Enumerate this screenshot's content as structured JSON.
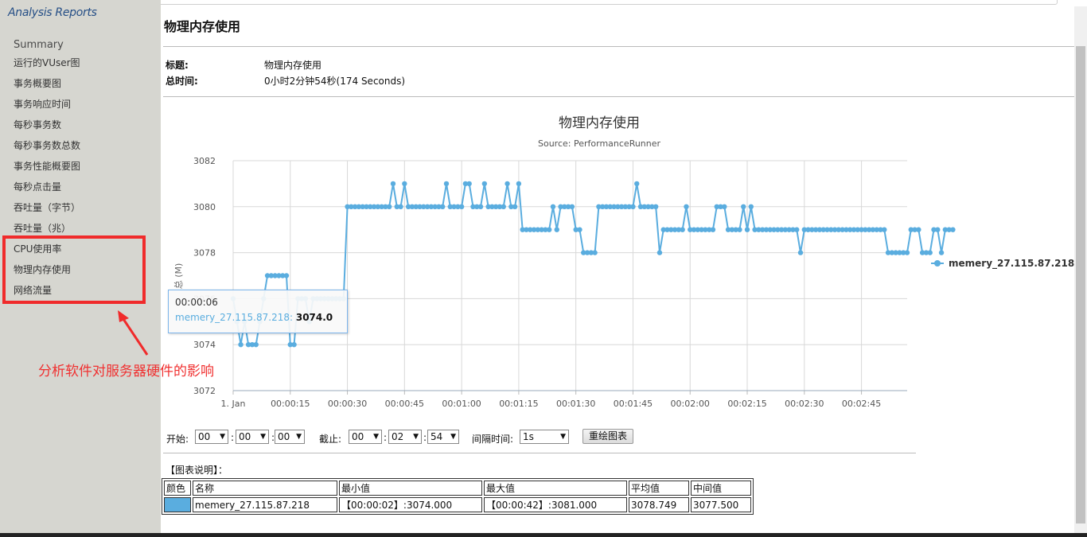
{
  "app": {
    "brand": "Analysis Reports"
  },
  "sidebar": {
    "items": [
      {
        "label": "Summary"
      },
      {
        "label": "运行的VUser图"
      },
      {
        "label": "事务概要图"
      },
      {
        "label": "事务响应时间"
      },
      {
        "label": "每秒事务数"
      },
      {
        "label": "每秒事务数总数"
      },
      {
        "label": "事务性能概要图"
      },
      {
        "label": "每秒点击量"
      },
      {
        "label": "吞吐量（字节）"
      },
      {
        "label": "吞吐量（兆）"
      },
      {
        "label": "CPU使用率"
      },
      {
        "label": "物理内存使用"
      },
      {
        "label": "网络流量"
      }
    ]
  },
  "annotation": {
    "text": "分析软件对服务器硬件的影响",
    "color": "#f03030"
  },
  "page": {
    "title": "物理内存使用",
    "info": [
      {
        "label": "标题:",
        "value": "物理内存使用"
      },
      {
        "label": "总时间:",
        "value": "0小时2分钟54秒(174 Seconds)"
      }
    ]
  },
  "chart_data": {
    "type": "line",
    "title": "物理内存使用",
    "subtitle": "Source: PerformanceRunner",
    "ylabel": "总 (M)",
    "ylim": [
      3072,
      3082
    ],
    "yticks": [
      "3082",
      "3080",
      "3078",
      "3076",
      "3074",
      "3072"
    ],
    "xlim": [
      0,
      177
    ],
    "xticks": [
      {
        "t": 0,
        "label": "1. Jan"
      },
      {
        "t": 15,
        "label": "00:00:15"
      },
      {
        "t": 30,
        "label": "00:00:30"
      },
      {
        "t": 45,
        "label": "00:00:45"
      },
      {
        "t": 60,
        "label": "00:01:00"
      },
      {
        "t": 75,
        "label": "00:01:15"
      },
      {
        "t": 90,
        "label": "00:01:30"
      },
      {
        "t": 105,
        "label": "00:01:45"
      },
      {
        "t": 120,
        "label": "00:02:00"
      },
      {
        "t": 135,
        "label": "00:02:15"
      },
      {
        "t": 150,
        "label": "00:02:30"
      },
      {
        "t": 165,
        "label": "00:02:45"
      }
    ],
    "grid": true,
    "legend_position": "right",
    "series": [
      {
        "name": "memery_27.115.87.218",
        "color": "#5aaddf",
        "values": [
          3076,
          3075,
          3074,
          3075,
          3074,
          3074,
          3074,
          3075,
          3076,
          3077,
          3077,
          3077,
          3077,
          3077,
          3077,
          3074,
          3074,
          3076,
          3076,
          3076,
          3075,
          3076,
          3076,
          3076,
          3076,
          3076,
          3076,
          3076,
          3076,
          3076,
          3080,
          3080,
          3080,
          3080,
          3080,
          3080,
          3080,
          3080,
          3080,
          3080,
          3080,
          3080,
          3081,
          3080,
          3080,
          3081,
          3080,
          3080,
          3080,
          3080,
          3080,
          3080,
          3080,
          3080,
          3080,
          3080,
          3081,
          3080,
          3080,
          3080,
          3080,
          3081,
          3081,
          3080,
          3080,
          3080,
          3081,
          3080,
          3080,
          3080,
          3080,
          3080,
          3081,
          3080,
          3080,
          3081,
          3079,
          3079,
          3079,
          3079,
          3079,
          3079,
          3079,
          3079,
          3080,
          3079,
          3080,
          3080,
          3080,
          3080,
          3079,
          3079,
          3078,
          3078,
          3078,
          3078,
          3080,
          3080,
          3080,
          3080,
          3080,
          3080,
          3080,
          3080,
          3080,
          3080,
          3081,
          3080,
          3080,
          3080,
          3080,
          3080,
          3078,
          3079,
          3079,
          3079,
          3079,
          3079,
          3079,
          3080,
          3079,
          3079,
          3079,
          3079,
          3079,
          3079,
          3079,
          3080,
          3080,
          3080,
          3079,
          3079,
          3079,
          3079,
          3080,
          3079,
          3080,
          3079,
          3079,
          3079,
          3079,
          3079,
          3079,
          3079,
          3079,
          3079,
          3079,
          3079,
          3079,
          3078,
          3079,
          3079,
          3079,
          3079,
          3079,
          3079,
          3079,
          3079,
          3079,
          3079,
          3079,
          3079,
          3079,
          3079,
          3079,
          3079,
          3079,
          3079,
          3079,
          3079,
          3079,
          3079,
          3078,
          3078,
          3078,
          3078,
          3078,
          3078,
          3079,
          3079,
          3079,
          3078,
          3078,
          3078,
          3079,
          3079,
          3078,
          3079,
          3079,
          3079
        ]
      }
    ]
  },
  "tooltip": {
    "time": "00:00:06",
    "series": "memery_27.115.87.218:",
    "value": "3074.0"
  },
  "controls": {
    "start_label": "开始:",
    "end_label": "截止:",
    "interval_label": "间隔时间:",
    "start": [
      "00",
      "00",
      "00"
    ],
    "end": [
      "00",
      "02",
      "54"
    ],
    "interval": "1s",
    "redraw_button": "重绘图表",
    "sep": ":"
  },
  "legend_table": {
    "title": "【图表说明】：",
    "headers": [
      "颜色",
      "名称",
      "最小值",
      "最大值",
      "平均值",
      "中间值"
    ],
    "rows": [
      {
        "color": "#5aaddf",
        "name": "memery_27.115.87.218",
        "min": "【00:00:02】:3074.000",
        "max": "【00:00:42】:3081.000",
        "avg": "3078.749",
        "median": "3077.500"
      }
    ]
  }
}
